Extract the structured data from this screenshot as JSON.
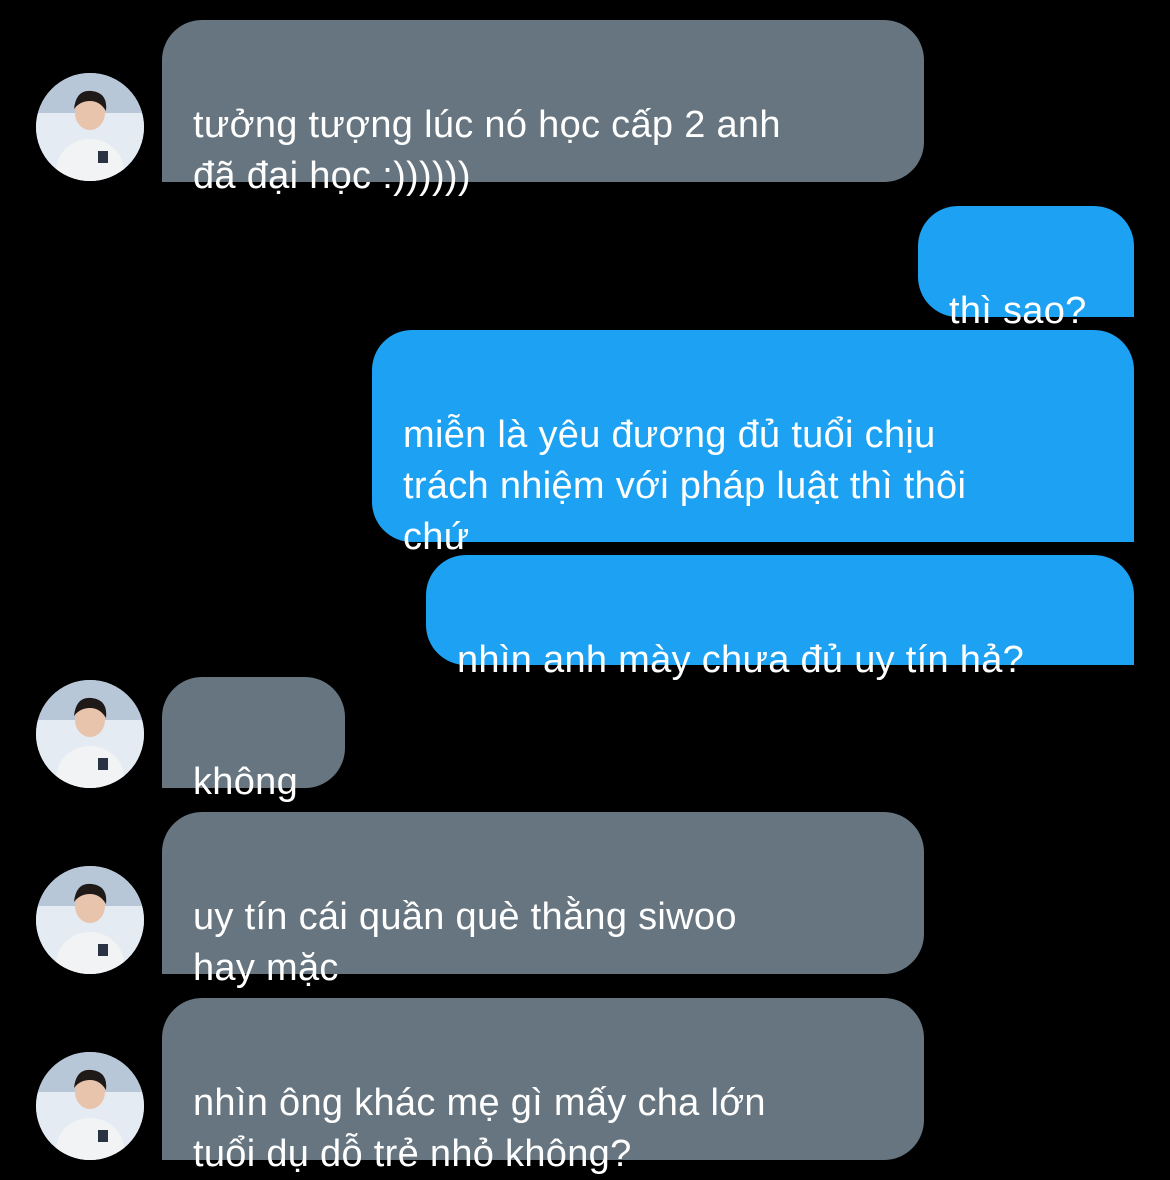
{
  "messages": [
    {
      "sender": "other",
      "text": "tưởng tượng lúc nó học cấp 2 anh\nđã đại học :))))))"
    },
    {
      "sender": "me",
      "text": "thì sao?"
    },
    {
      "sender": "me",
      "text": "miễn là yêu đương đủ tuổi chịu\ntrách nhiệm với pháp luật thì thôi\nchứ"
    },
    {
      "sender": "me",
      "text": "nhìn anh mày chưa đủ uy tín hả?"
    },
    {
      "sender": "other",
      "text": "không"
    },
    {
      "sender": "other",
      "text": "uy tín cái quần què thằng siwoo\nhay mặc"
    },
    {
      "sender": "other",
      "text": "nhìn ông khác mẹ gì mấy cha lớn\ntuổi dụ dỗ trẻ nhỏ không?"
    }
  ],
  "colors": {
    "background": "#000000",
    "incoming_bubble": "#66757f",
    "outgoing_bubble": "#1da1f2",
    "text": "#ffffff"
  },
  "icons": {
    "avatar": "user-avatar-photo"
  }
}
